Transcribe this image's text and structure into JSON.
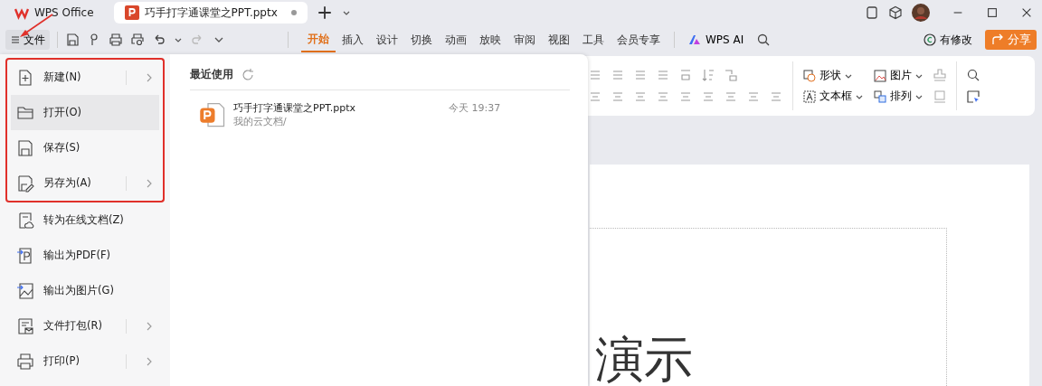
{
  "tabs": [
    {
      "label": "WPS Office",
      "kind": "home",
      "selected": false
    },
    {
      "label": "巧手打字通课堂之PPT.pptx",
      "kind": "doc",
      "selected": true,
      "modified": true
    }
  ],
  "file_button": "文件",
  "ribbon_tabs": [
    {
      "label": "开始",
      "selected": true
    },
    {
      "label": "插入",
      "selected": false
    },
    {
      "label": "设计",
      "selected": false
    },
    {
      "label": "切换",
      "selected": false
    },
    {
      "label": "动画",
      "selected": false
    },
    {
      "label": "放映",
      "selected": false
    },
    {
      "label": "审阅",
      "selected": false
    },
    {
      "label": "视图",
      "selected": false
    },
    {
      "label": "工具",
      "selected": false
    },
    {
      "label": "会员专享",
      "selected": false
    }
  ],
  "wps_ai": "WPS AI",
  "save_status": "有修改",
  "share_button": "分享",
  "ribbon_tools": [
    {
      "label": "形状",
      "kind": "shape"
    },
    {
      "label": "图片",
      "kind": "image"
    },
    {
      "label": "文本框",
      "kind": "textbox"
    },
    {
      "label": "排列",
      "kind": "arrange"
    }
  ],
  "file_menu": [
    {
      "label": "新建(N)",
      "kind": "new",
      "submenu": true,
      "hovered": false,
      "in_callout": true
    },
    {
      "label": "打开(O)",
      "kind": "open",
      "submenu": false,
      "hovered": true,
      "in_callout": true
    },
    {
      "label": "保存(S)",
      "kind": "save",
      "submenu": false,
      "hovered": false,
      "in_callout": true
    },
    {
      "label": "另存为(A)",
      "kind": "saveas",
      "submenu": true,
      "hovered": false,
      "in_callout": true
    },
    {
      "label": "转为在线文档(Z)",
      "kind": "online",
      "submenu": false,
      "hovered": false,
      "in_callout": false
    },
    {
      "label": "输出为PDF(F)",
      "kind": "pdf",
      "submenu": false,
      "hovered": false,
      "in_callout": false
    },
    {
      "label": "输出为图片(G)",
      "kind": "image",
      "submenu": false,
      "hovered": false,
      "in_callout": false
    },
    {
      "label": "文件打包(R)",
      "kind": "package",
      "submenu": true,
      "hovered": false,
      "in_callout": false
    },
    {
      "label": "打印(P)",
      "kind": "print",
      "submenu": true,
      "hovered": false,
      "in_callout": false
    }
  ],
  "recent": {
    "title": "最近使用",
    "files": [
      {
        "name": "巧手打字通课堂之PPT.pptx",
        "location": "我的云文档/",
        "time": "今天 19:37"
      }
    ]
  },
  "slide": {
    "title_fragment": "演示"
  }
}
